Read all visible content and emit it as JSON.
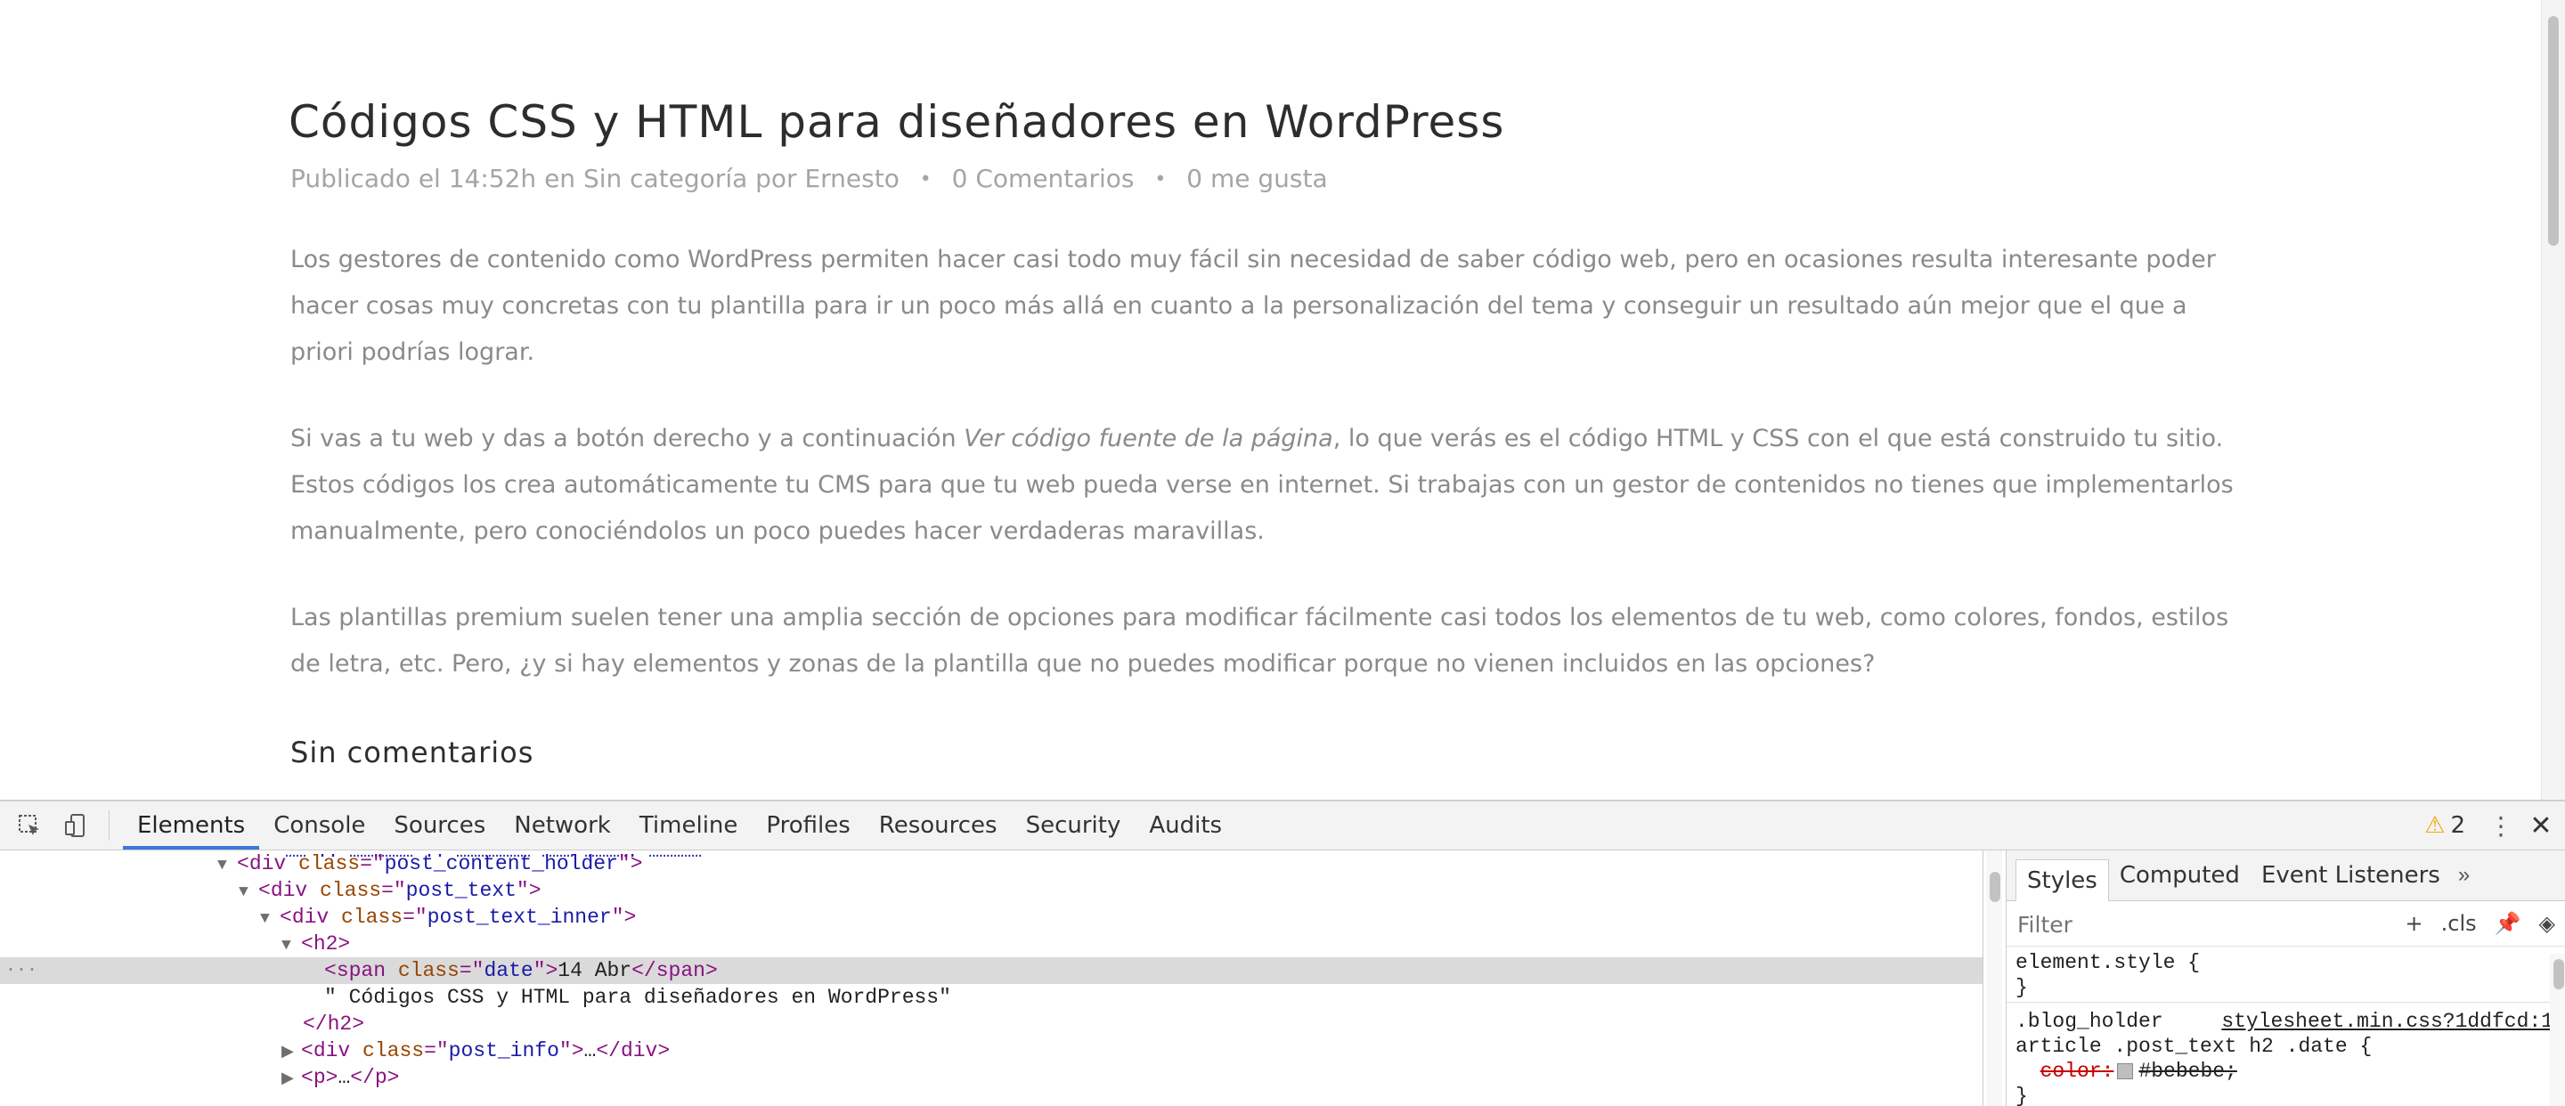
{
  "article": {
    "title": "Códigos CSS y HTML para diseñadores en WordPress",
    "meta": {
      "published": "Publicado el 14:52h en Sin categoría por Ernesto",
      "comments": "0 Comentarios",
      "likes_count": "0",
      "likes_label": "me gusta"
    },
    "paragraphs": [
      "Los gestores de contenido como WordPress permiten hacer casi todo muy fácil sin necesidad de saber código web, pero en ocasiones resulta interesante poder hacer cosas muy concretas con tu plantilla para ir un poco más allá en cuanto a la personalización del tema y conseguir un resultado aún mejor que el que a priori podrías lograr.",
      "Las plantillas premium suelen tener una amplia sección de opciones para modificar fácilmente casi todos los elementos de tu web, como colores, fondos, estilos de letra, etc. Pero, ¿y si hay elementos y zonas de la plantilla que no puedes modificar porque no vienen incluidos en las opciones?"
    ],
    "paragraph2": {
      "before": "Si vas a tu web y das a botón derecho y a continuación ",
      "emphasis": "Ver código fuente de la página",
      "after": ", lo que verás es el código HTML y CSS con el que está construido tu sitio. Estos códigos los crea automáticamente tu CMS para que tu web pueda verse en internet. Si trabajas con un gestor de contenidos no tienes que implementarlos manualmente, pero conociéndolos un poco puedes hacer verdaderas maravillas."
    },
    "comments_heading": "Sin comentarios"
  },
  "devtools": {
    "tabs": [
      "Elements",
      "Console",
      "Sources",
      "Network",
      "Timeline",
      "Profiles",
      "Resources",
      "Security",
      "Audits"
    ],
    "active_tab": "Elements",
    "warnings_count": "2",
    "dom": {
      "line1": {
        "tag": "div",
        "attr": "class",
        "val": "post_content_holder"
      },
      "line2": {
        "tag": "div",
        "attr": "class",
        "val": "post_text"
      },
      "line3": {
        "tag": "div",
        "attr": "class",
        "val": "post_text_inner"
      },
      "line4": {
        "tag": "h2"
      },
      "line5": {
        "tag": "span",
        "attr": "class",
        "val": "date",
        "text": "14 Abr"
      },
      "line6": {
        "text": "\" Códigos CSS y HTML para diseñadores en WordPress\""
      },
      "line7": {
        "tag": "h2"
      },
      "line8": {
        "tag": "div",
        "attr": "class",
        "val": "post_info",
        "text": "…"
      },
      "line9": {
        "tag": "p",
        "text": "…"
      }
    },
    "sidebar": {
      "tabs": [
        "Styles",
        "Computed",
        "Event Listeners"
      ],
      "more": "»",
      "filter_placeholder": "Filter",
      "add_label": "+",
      "cls_label": ".cls",
      "rules": [
        {
          "selector": "element.style {",
          "close": "}"
        },
        {
          "selector": ".blog_holder",
          "selector2": "article .post_text h2 .date {",
          "source": "stylesheet.min.css?1ddfcd:1",
          "property": "color:",
          "value": "#bebebe;",
          "close": "}"
        }
      ]
    }
  }
}
